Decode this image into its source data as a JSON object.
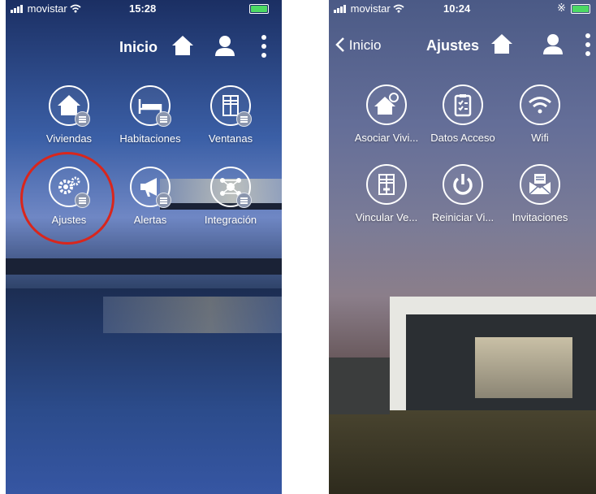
{
  "left": {
    "status": {
      "carrier": "movistar",
      "time": "15:28"
    },
    "nav": {
      "title": "Inicio"
    },
    "tiles": [
      {
        "label": "Viviendas",
        "icon": "house-icon"
      },
      {
        "label": "Habitaciones",
        "icon": "bed-icon"
      },
      {
        "label": "Ventanas",
        "icon": "window-icon"
      },
      {
        "label": "Ajustes",
        "icon": "gears-icon"
      },
      {
        "label": "Alertas",
        "icon": "megaphone-icon"
      },
      {
        "label": "Integración",
        "icon": "network-icon"
      }
    ],
    "highlight_color": "#d9261c"
  },
  "right": {
    "status": {
      "carrier": "movistar",
      "time": "10:24"
    },
    "nav": {
      "back_label": "Inicio",
      "title": "Ajustes"
    },
    "tiles": [
      {
        "label": "Asociar Vivi...",
        "icon": "house-link-icon"
      },
      {
        "label": "Datos Acceso",
        "icon": "clipboard-icon"
      },
      {
        "label": "Wifi",
        "icon": "wifi-icon"
      },
      {
        "label": "Vincular Ve...",
        "icon": "window-link-icon"
      },
      {
        "label": "Reiniciar Vi...",
        "icon": "power-icon"
      },
      {
        "label": "Invitaciones",
        "icon": "envelope-icon"
      }
    ]
  },
  "colors": {
    "battery": "#4cd964",
    "icon_stroke": "#ffffff"
  }
}
